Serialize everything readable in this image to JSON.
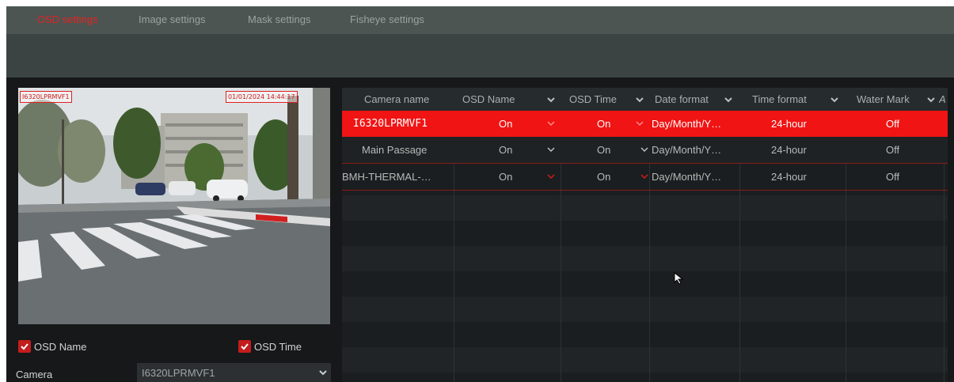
{
  "tabs": [
    {
      "label": "OSD settings",
      "active": true
    },
    {
      "label": "Image settings",
      "active": false
    },
    {
      "label": "Mask settings",
      "active": false
    },
    {
      "label": "Fisheye settings",
      "active": false
    }
  ],
  "preview": {
    "osd_name_overlay": "I6320LPRMVF1",
    "osd_time_overlay": "01/01/2024 14:44:17"
  },
  "options": {
    "osd_name": {
      "label": "OSD Name",
      "checked": true
    },
    "osd_time": {
      "label": "OSD Time",
      "checked": true
    }
  },
  "camera": {
    "label": "Camera",
    "value": "I6320LPRMVF1"
  },
  "table": {
    "columns": [
      "Camera name",
      "OSD Name",
      "OSD Time",
      "Date format",
      "Time format",
      "Water Mark",
      "A"
    ],
    "rows": [
      {
        "camera_name": "I6320LPRMVF1",
        "osd_name": "On",
        "osd_time": "On",
        "date_format": "Day/Month/Y…",
        "time_format": "24-hour",
        "water_mark": "Off",
        "selected": true
      },
      {
        "camera_name": "Main Passage",
        "osd_name": "On",
        "osd_time": "On",
        "date_format": "Day/Month/Y…",
        "time_format": "24-hour",
        "water_mark": "Off",
        "selected": false
      },
      {
        "camera_name": "BMH-THERMAL-…",
        "osd_name": "On",
        "osd_time": "On",
        "date_format": "Day/Month/Y…",
        "time_format": "24-hour",
        "water_mark": "Off",
        "selected": false
      }
    ]
  },
  "colors": {
    "accent": "#e52222",
    "selected_row": "#f01414",
    "background": "#161819"
  },
  "icons": {
    "dropdown": "chevron-down-icon",
    "checkbox": "checkmark-icon",
    "pointer": "mouse-cursor-icon"
  }
}
